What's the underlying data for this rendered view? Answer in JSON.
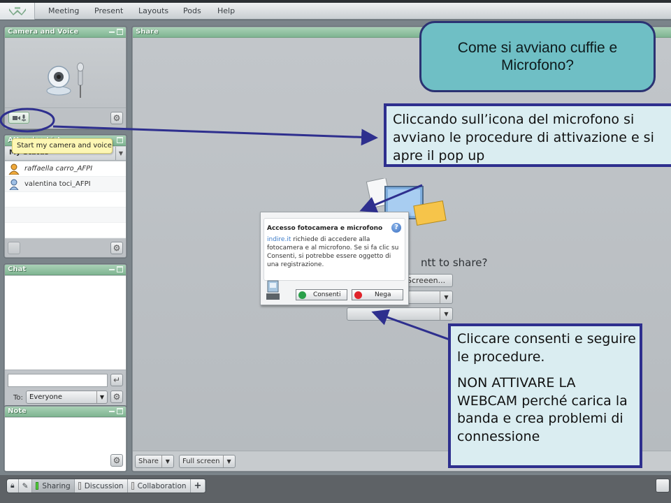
{
  "menubar": {
    "items": [
      "Meeting",
      "Present",
      "Layouts",
      "Pods",
      "Help"
    ]
  },
  "pods": {
    "camera": {
      "title": "Camera and Voice",
      "start_button_icons": [
        "camera-icon",
        "microphone-icon"
      ]
    },
    "attendees": {
      "title": "Attendee List",
      "status_label": "My Status",
      "tooltip": "Start my camera and voice",
      "attendees": [
        {
          "name": "raffaella carro_AFPI",
          "role": "host",
          "italic": true
        },
        {
          "name": "valentina toci_AFPI",
          "role": "participant",
          "italic": false
        }
      ]
    },
    "chat": {
      "title": "Chat",
      "input_value": "",
      "to_label": "To:",
      "to_value": "Everyone"
    },
    "note": {
      "title": "Note"
    },
    "share": {
      "title": "Share",
      "question": "ntt to share?",
      "option_screen": "Scre​een...",
      "footer": {
        "share_label": "Share",
        "fullscreen_label": "Full screen"
      }
    }
  },
  "dialog": {
    "title": "Accesso fotocamera e microfono",
    "host": "indire.it",
    "text": " richiede di accedere alla fotocamera e al microfono. Se si fa clic su Consenti, si potrebbe essere oggetto di una registrazione.",
    "allow_label": "Consenti",
    "deny_label": "Nega",
    "help_glyph": "?"
  },
  "bottombar": {
    "tabs": [
      {
        "label": "Sharing",
        "active": true
      },
      {
        "label": "Discussion",
        "active": false
      },
      {
        "label": "Collaboration",
        "active": false
      }
    ],
    "add_label": "+"
  },
  "annotations": {
    "title_line1": "Come si avviano cuffie e",
    "title_line2": "Microfono?",
    "callout1": "Cliccando sull’icona del microfono si avviano le procedure di attivazione e si apre il pop up",
    "callout2_p1": "Cliccare consenti e seguire le procedure.",
    "callout2_p2": "NON ATTIVARE LA WEBCAM perché carica la banda e crea problemi di connessione",
    "accent_color": "#2e2f8e",
    "title_bg": "#6fbfc5"
  }
}
